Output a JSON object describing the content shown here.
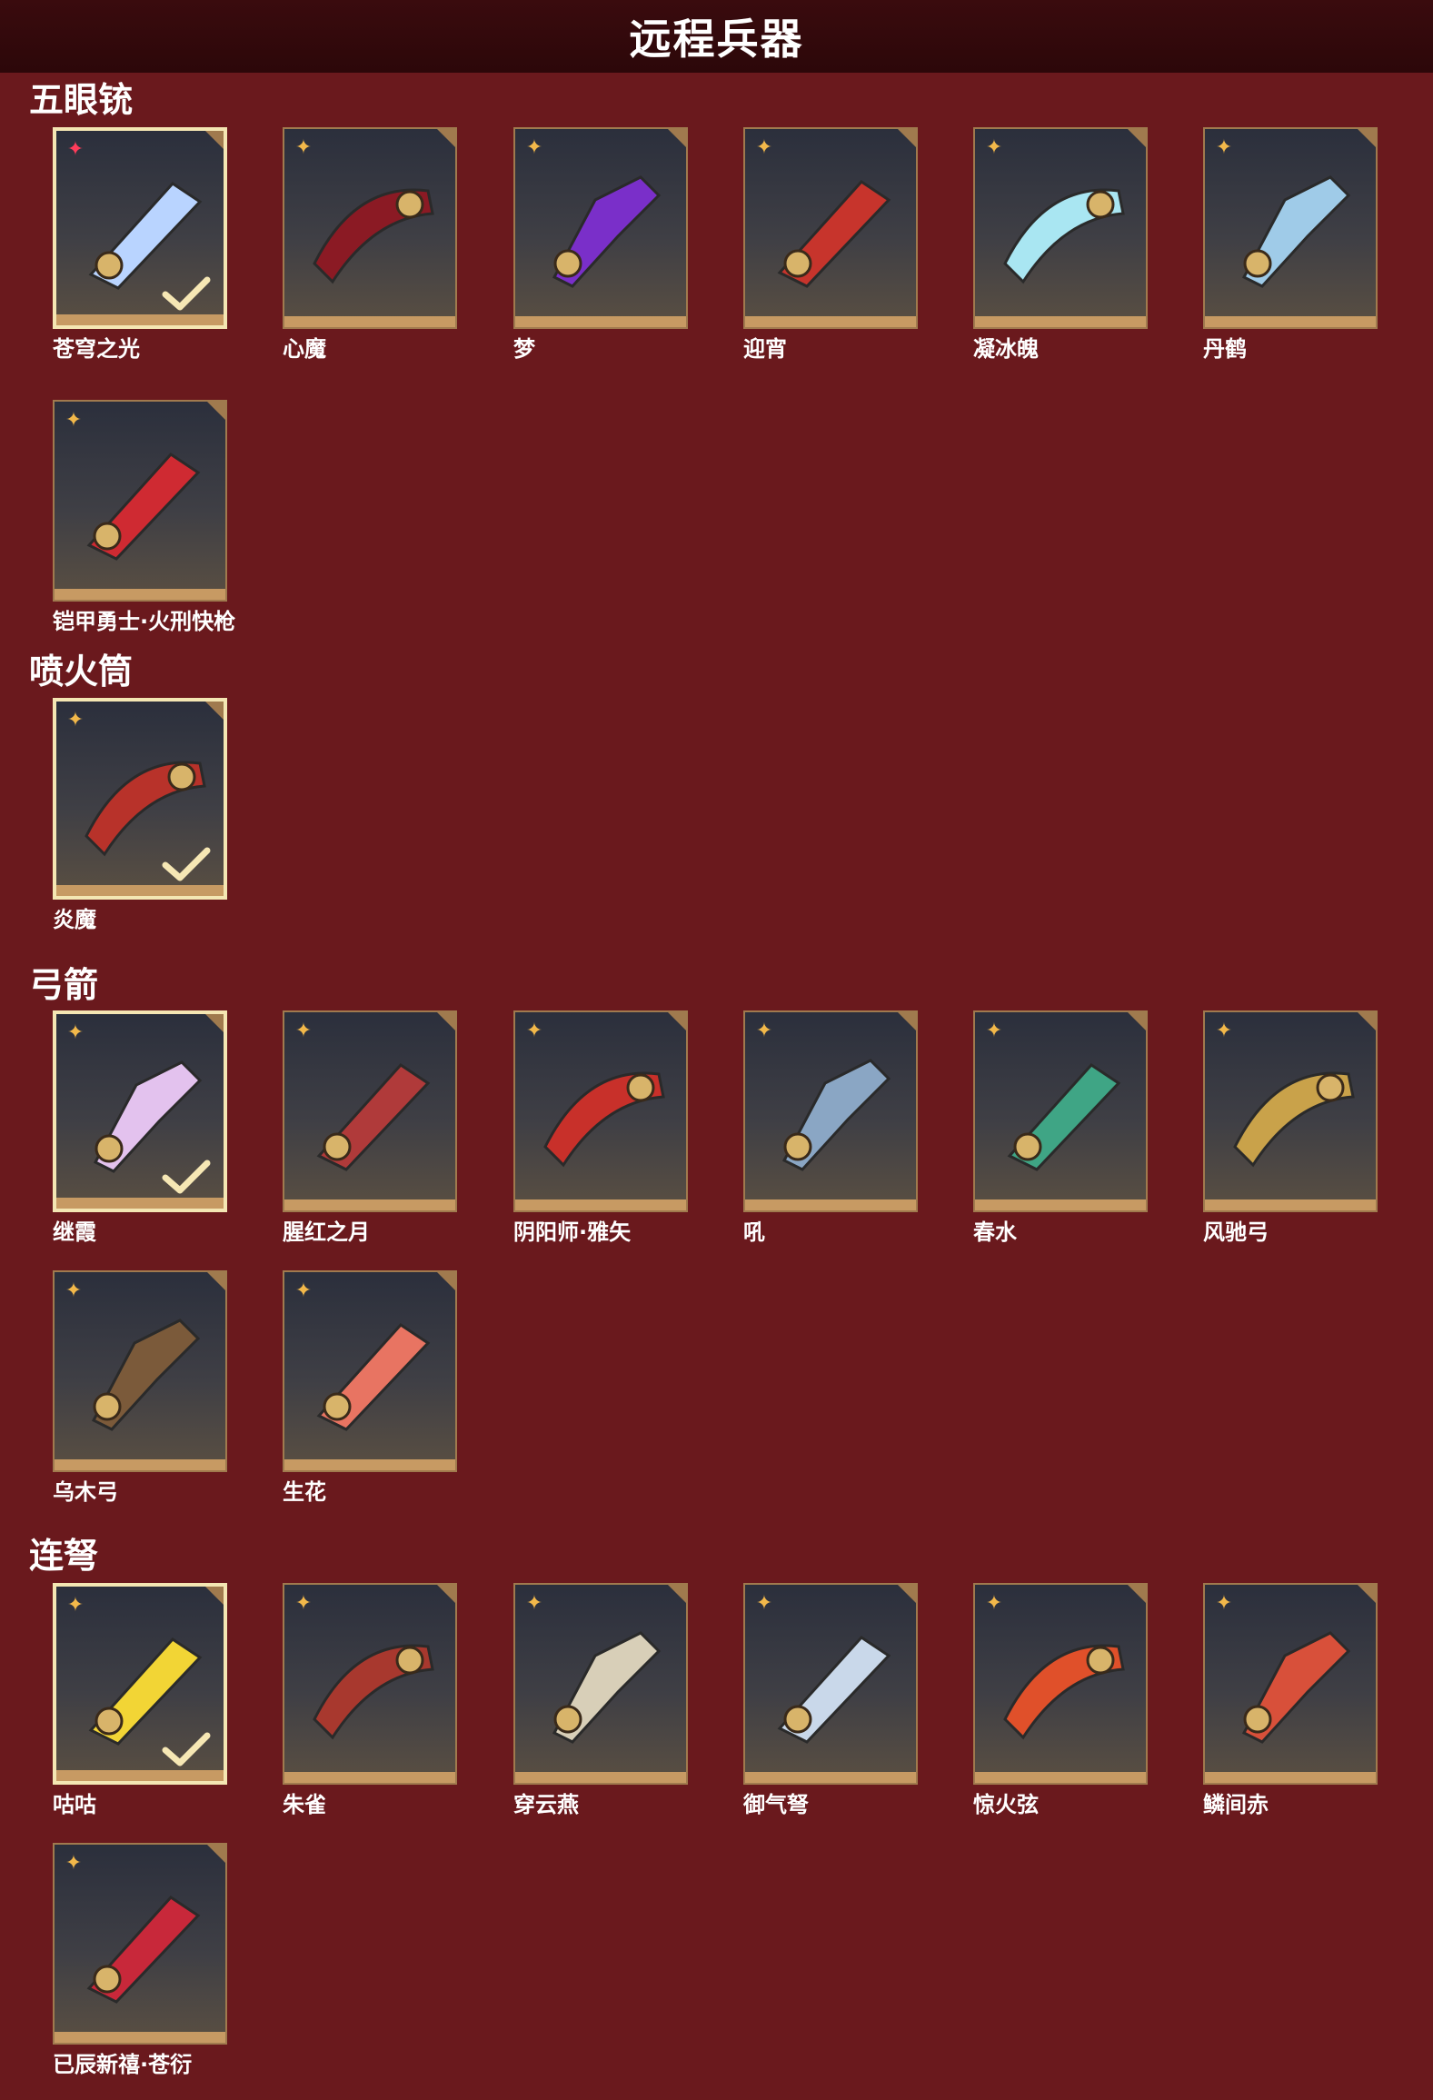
{
  "header": {
    "title": "远程兵器"
  },
  "sections": [
    {
      "title": "五眼铳",
      "items": [
        {
          "name": "苍穹之光",
          "selected": true,
          "rank": "red"
        },
        {
          "name": "心魔"
        },
        {
          "name": "梦"
        },
        {
          "name": "迎宵"
        },
        {
          "name": "凝冰魄"
        },
        {
          "name": "丹鹤"
        },
        {
          "name": "铠甲勇士·火刑快枪"
        }
      ]
    },
    {
      "title": "喷火筒",
      "items": [
        {
          "name": "炎魔",
          "selected": true
        }
      ]
    },
    {
      "title": "弓箭",
      "items": [
        {
          "name": "继霞",
          "selected": true
        },
        {
          "name": "腥红之月"
        },
        {
          "name": "阴阳师·雅矢"
        },
        {
          "name": "吼"
        },
        {
          "name": "春水"
        },
        {
          "name": "风驰弓"
        },
        {
          "name": "乌木弓"
        },
        {
          "name": "生花"
        }
      ]
    },
    {
      "title": "连弩",
      "items": [
        {
          "name": "咕咕",
          "selected": true
        },
        {
          "name": "朱雀"
        },
        {
          "name": "穿云燕"
        },
        {
          "name": "御气弩"
        },
        {
          "name": "惊火弦"
        },
        {
          "name": "鳞间赤"
        },
        {
          "name": "已辰新禧·苍衍"
        }
      ]
    }
  ],
  "icons": {
    "rank": "rarity-star-icon",
    "check": "equipped-check-icon",
    "weapon": "weapon-thumbnail-icon"
  },
  "colors": {
    "background": "#6a191d",
    "header": "#2c0709",
    "tile_border": "#a07a4e",
    "selected_border": "#f4e6b3",
    "rank_gold": "#f2b84a",
    "rank_red": "#ff3c5a"
  },
  "weapon_colors": {
    "苍穹之光": "#b9d4ff",
    "心魔": "#8b1a24",
    "梦": "#7a2fc9",
    "迎宵": "#c7342c",
    "凝冰魄": "#a9e6f2",
    "丹鹤": "#9fcbe8",
    "铠甲勇士·火刑快枪": "#cf2a32",
    "炎魔": "#b8322a",
    "继霞": "#e3c2ee",
    "腥红之月": "#b03a3a",
    "阴阳师·雅矢": "#c8302a",
    "吼": "#8aa6c4",
    "春水": "#3fa585",
    "风驰弓": "#c9a24a",
    "乌木弓": "#7b5a3a",
    "生花": "#e87462",
    "咕咕": "#f2d535",
    "朱雀": "#a8382e",
    "穿云燕": "#d8cfb8",
    "御气弩": "#c9d8ea",
    "惊火弦": "#e0502a",
    "鳞间赤": "#d8503a",
    "已辰新禧·苍衍": "#c8283a"
  }
}
